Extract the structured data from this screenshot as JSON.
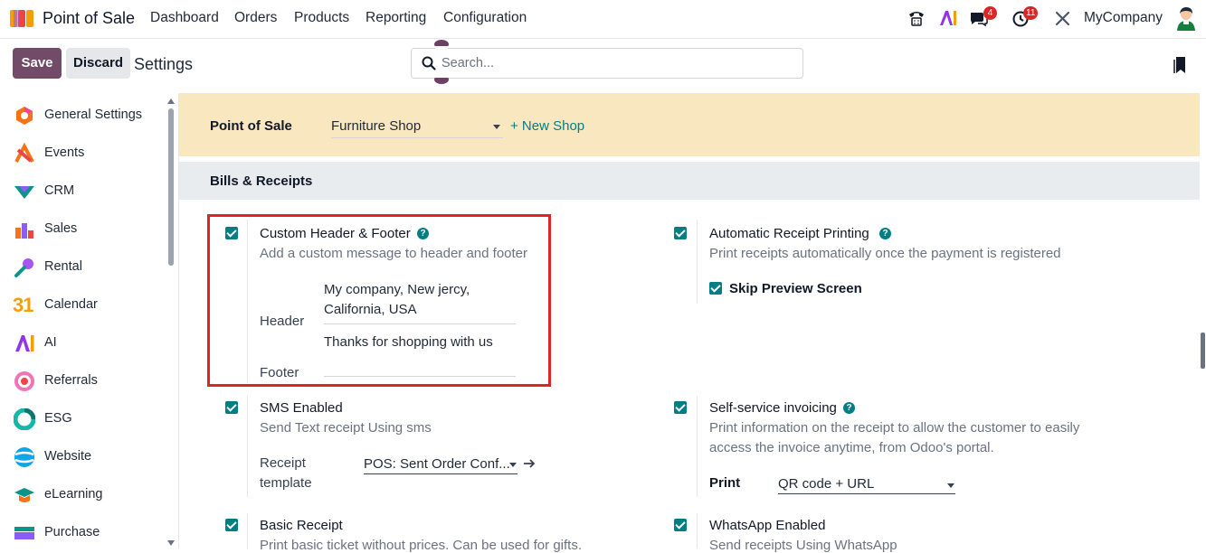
{
  "navbar": {
    "app_name": "Point of Sale",
    "menu": [
      "Dashboard",
      "Orders",
      "Products",
      "Reporting",
      "Configuration"
    ],
    "chat_badge": "4",
    "activity_badge": "11",
    "company": "MyCompany",
    "ai_label": "AI"
  },
  "control": {
    "save_label": "Save",
    "discard_label": "Discard",
    "breadcrumb": "Settings",
    "search_placeholder": "Search..."
  },
  "sidebar": {
    "items": [
      {
        "label": "General Settings",
        "icon": "general-settings-icon"
      },
      {
        "label": "Events",
        "icon": "events-icon"
      },
      {
        "label": "CRM",
        "icon": "crm-icon"
      },
      {
        "label": "Sales",
        "icon": "sales-icon"
      },
      {
        "label": "Rental",
        "icon": "rental-icon"
      },
      {
        "label": "Calendar",
        "icon": "calendar-icon"
      },
      {
        "label": "AI",
        "icon": "ai-icon"
      },
      {
        "label": "Referrals",
        "icon": "referrals-icon"
      },
      {
        "label": "ESG",
        "icon": "esg-icon"
      },
      {
        "label": "Website",
        "icon": "website-icon"
      },
      {
        "label": "eLearning",
        "icon": "elearning-icon"
      },
      {
        "label": "Purchase",
        "icon": "purchase-icon"
      }
    ],
    "calendar_number": "31"
  },
  "shop": {
    "label": "Point of Sale",
    "selected": "Furniture Shop",
    "new_shop": "+ New Shop"
  },
  "section": {
    "title": "Bills & Receipts"
  },
  "settings": {
    "custom_header_footer": {
      "title": "Custom Header & Footer",
      "desc": "Add a custom message to header and footer",
      "header_label": "Header",
      "header_line1": "My company, New jercy,",
      "header_line2": "California, USA",
      "footer_label": "Footer",
      "footer_value": "Thanks for shopping with us"
    },
    "auto_receipt": {
      "title": "Automatic Receipt Printing",
      "desc": "Print receipts automatically once the payment is registered",
      "skip_preview": "Skip Preview Screen"
    },
    "sms": {
      "title": "SMS Enabled",
      "desc": "Send Text receipt Using sms",
      "template_label_1": "Receipt",
      "template_label_2": "template",
      "template_value": "POS: Sent Order Conf..."
    },
    "self_service": {
      "title": "Self-service invoicing",
      "desc_1": "Print information on the receipt to allow the customer to easily",
      "desc_2": "access the invoice anytime, from Odoo's portal.",
      "print_label": "Print",
      "print_value": "QR code + URL"
    },
    "basic_receipt": {
      "title": "Basic Receipt",
      "desc": "Print basic ticket without prices. Can be used for gifts."
    },
    "whatsapp": {
      "title": "WhatsApp Enabled",
      "desc": "Send receipts Using WhatsApp"
    }
  },
  "colors": {
    "brand": "#714b67",
    "accent": "#017e84",
    "highlight_box": "#dc2626",
    "shop_bar": "#f9e7c0"
  }
}
